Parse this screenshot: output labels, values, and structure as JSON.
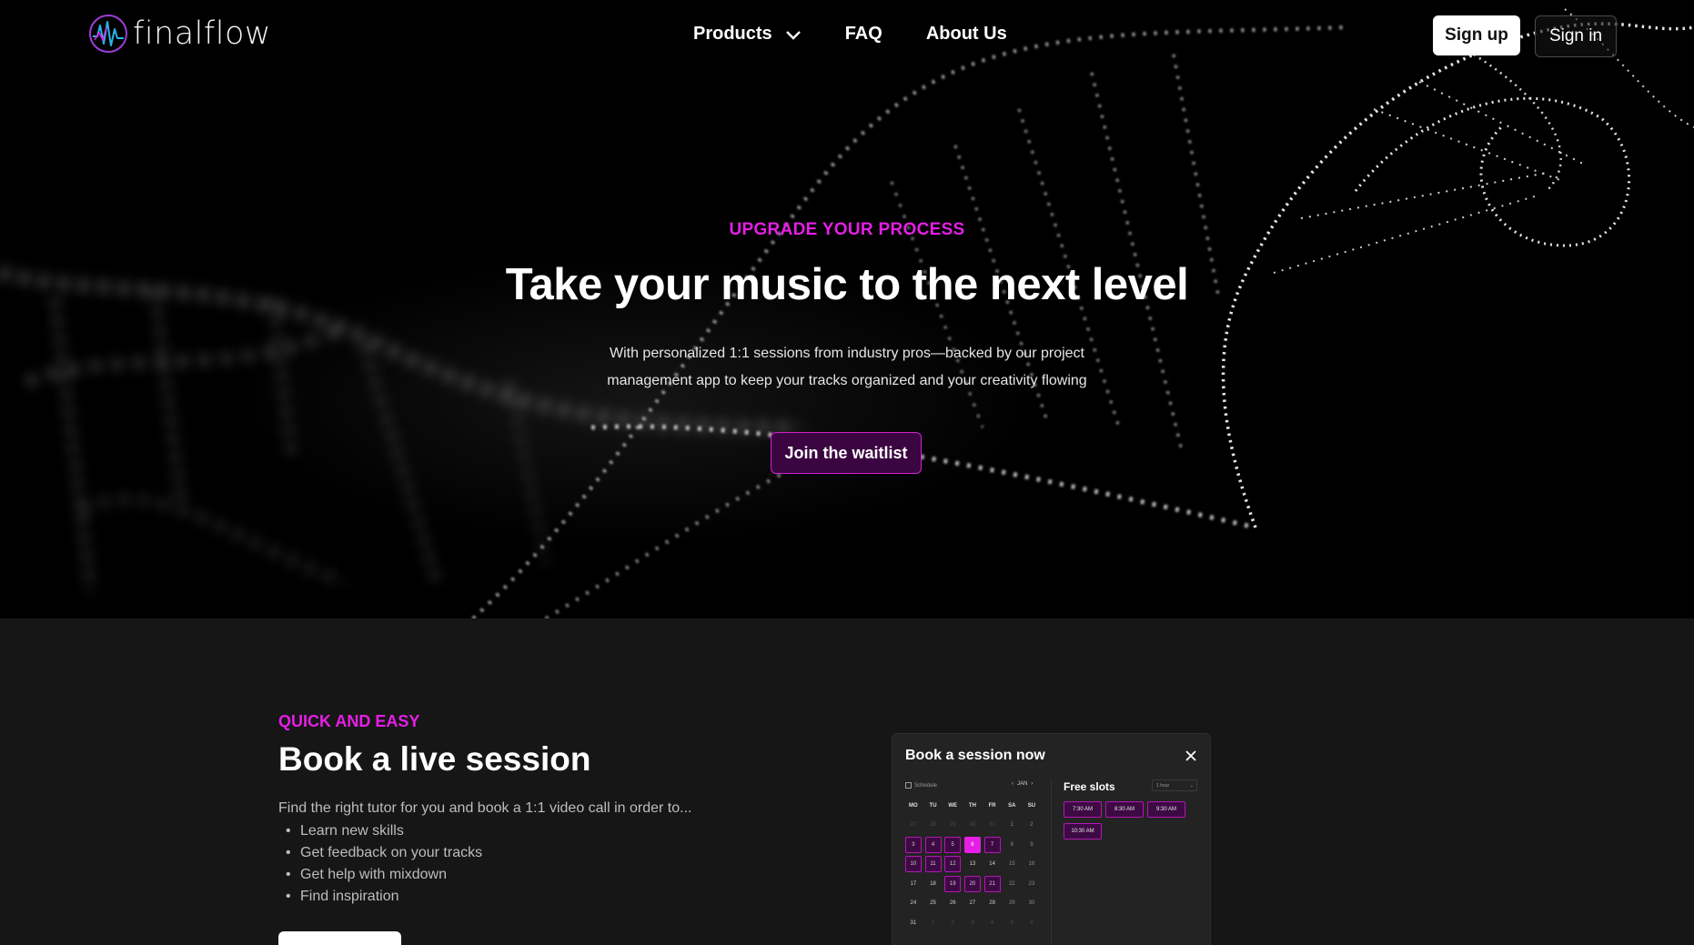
{
  "brand": {
    "name": "finalflow",
    "logo_icon": "waveform-circle-logo"
  },
  "nav": {
    "items": [
      {
        "label": "Products",
        "has_dropdown": true
      },
      {
        "label": "FAQ"
      },
      {
        "label": "About Us"
      }
    ],
    "signup_label": "Sign up",
    "signin_label": "Sign in"
  },
  "hero": {
    "eyebrow": "UPGRADE YOUR PROCESS",
    "title": "Take your music to the next level",
    "subtitle_line1": "With personalized 1:1 sessions from industry pros—backed by our project",
    "subtitle_line2": "management app to keep your tracks organized and your creativity flowing",
    "cta_label": "Join the waitlist"
  },
  "feature": {
    "eyebrow": "QUICK AND EASY",
    "title": "Book a live session",
    "description": "Find the right tutor for you and book a 1:1 video call in order to...",
    "bullets": [
      "Learn new skills",
      "Get feedback on your tracks",
      "Get help with mixdown",
      "Find inspiration"
    ]
  },
  "booking_card": {
    "title": "Book a session now",
    "schedule_label": "Schedule",
    "month_label": "JAN",
    "weekdays": [
      "MO",
      "TU",
      "WE",
      "TH",
      "FR",
      "SA",
      "SU"
    ],
    "weeks": [
      [
        "27",
        "28",
        "29",
        "30",
        "31",
        "1",
        "2"
      ],
      [
        "3",
        "4",
        "5",
        "6",
        "7",
        "8",
        "9"
      ],
      [
        "10",
        "11",
        "12",
        "13",
        "14",
        "15",
        "16"
      ],
      [
        "17",
        "18",
        "19",
        "20",
        "21",
        "22",
        "23"
      ],
      [
        "24",
        "25",
        "26",
        "27",
        "28",
        "29",
        "30"
      ],
      [
        "31",
        "1",
        "2",
        "3",
        "4",
        "5",
        "6"
      ]
    ],
    "selected_day": "6",
    "free_slots_label": "Free slots",
    "duration_value": "1 hour",
    "slots": [
      "7:30 AM",
      "8:30 AM",
      "9:30 AM",
      "10:30 AM"
    ]
  },
  "colors": {
    "accent": "#e61ee6",
    "accent_dark": "#3d0a44",
    "background_hero": "#000000",
    "background_section": "#161616",
    "card": "#232323"
  }
}
